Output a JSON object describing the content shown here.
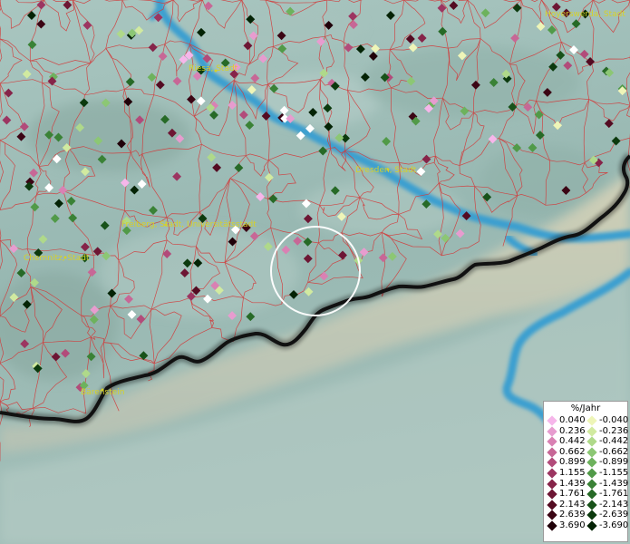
{
  "map": {
    "cities": [
      {
        "name": "Riesa, Stadt"
      },
      {
        "name": "Hoyerswerda, Stadt"
      },
      {
        "name": "Dresden, Stadt"
      },
      {
        "name": "Freiberg, Stadt, Universitätsstadt"
      },
      {
        "name": "Chemnitz, Stadt"
      },
      {
        "name": "Bärenstein"
      }
    ],
    "colors": {
      "terrain_base": "#9fbcb6",
      "river": "#3a9fd0",
      "district_border": "#d23a3a",
      "country_border": "#111111",
      "label": "#d6d12a"
    }
  },
  "legend": {
    "title": "%/Jahr",
    "positive": [
      {
        "value": "0.040",
        "color": "#f6b6ea"
      },
      {
        "value": "0.236",
        "color": "#e79ccf"
      },
      {
        "value": "0.442",
        "color": "#d981b3"
      },
      {
        "value": "0.662",
        "color": "#c76796"
      },
      {
        "value": "0.899",
        "color": "#b24b7a"
      },
      {
        "value": "1.155",
        "color": "#9c3561"
      },
      {
        "value": "1.439",
        "color": "#862449"
      },
      {
        "value": "1.761",
        "color": "#6d1634"
      },
      {
        "value": "2.143",
        "color": "#540b22"
      },
      {
        "value": "2.639",
        "color": "#3b0514"
      },
      {
        "value": "3.690",
        "color": "#200009"
      }
    ],
    "negative": [
      {
        "value": "-0.040",
        "color": "#eef5b8"
      },
      {
        "value": "-0.236",
        "color": "#d1eaa0"
      },
      {
        "value": "-0.442",
        "color": "#afd98a"
      },
      {
        "value": "-0.662",
        "color": "#8cc774"
      },
      {
        "value": "-0.899",
        "color": "#6db25d"
      },
      {
        "value": "-1.155",
        "color": "#519a48"
      },
      {
        "value": "-1.439",
        "color": "#3a8236"
      },
      {
        "value": "-1.761",
        "color": "#276a27"
      },
      {
        "value": "-2.143",
        "color": "#18521a"
      },
      {
        "value": "-2.639",
        "color": "#0c3a0e"
      },
      {
        "value": "-3.690",
        "color": "#042305"
      }
    ]
  }
}
